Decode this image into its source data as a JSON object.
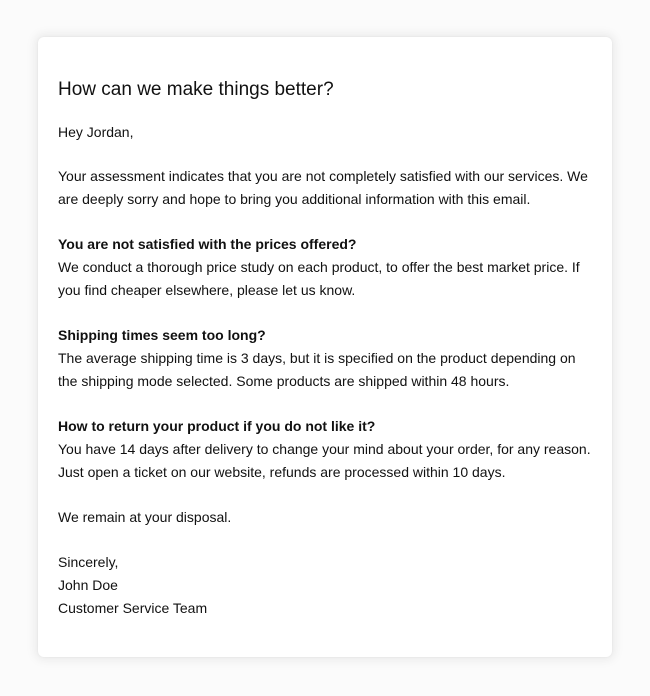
{
  "email": {
    "subject": "How can we make things better?",
    "greeting": "Hey Jordan,",
    "intro": "Your assessment indicates that you are not completely satisfied with our services. We are deeply sorry and hope to bring you additional information with this email.",
    "sections": [
      {
        "heading": "You are not satisfied with the prices offered?",
        "body": "We conduct a thorough price study on each product, to offer the best market price. If you find cheaper elsewhere, please let us know."
      },
      {
        "heading": "Shipping times seem too long?",
        "body": "The average shipping time is 3 days, but it is specified on the product depending on the shipping mode selected. Some products are shipped within 48 hours."
      },
      {
        "heading": "How to return your product if you do not like it?",
        "body": "You have 14 days after delivery to change your mind about your order, for any reason. Just open a ticket on our website, refunds are processed within 10 days."
      }
    ],
    "closing_note": "We remain at your disposal.",
    "signoff": "Sincerely,",
    "sender_name": "John Doe",
    "sender_team": "Customer Service Team"
  }
}
